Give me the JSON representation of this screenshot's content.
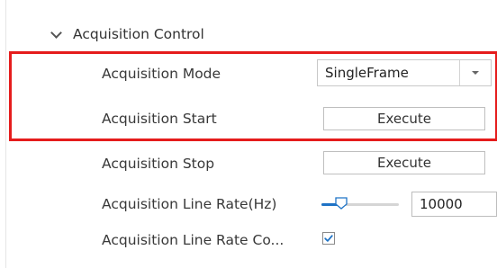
{
  "section": {
    "title": "Acquisition Control"
  },
  "properties": {
    "acquisition_mode": {
      "label": "Acquisition Mode",
      "value": "SingleFrame"
    },
    "acquisition_start": {
      "label": "Acquisition Start",
      "button": "Execute"
    },
    "acquisition_stop": {
      "label": "Acquisition Stop",
      "button": "Execute"
    },
    "line_rate": {
      "label": "Acquisition Line Rate(Hz)",
      "value": "10000",
      "slider_fraction": 0.25
    },
    "line_rate_control": {
      "label": "Acquisition Line Rate Co...",
      "checked": true
    }
  },
  "colors": {
    "highlight": "#e51c1c",
    "accent": "#1e73c6"
  },
  "icons": {
    "section_toggle": "chevron-down-icon",
    "dropdown": "triangle-down-icon",
    "slider_thumb": "slider-thumb-icon",
    "checkbox": "checkmark-icon"
  }
}
